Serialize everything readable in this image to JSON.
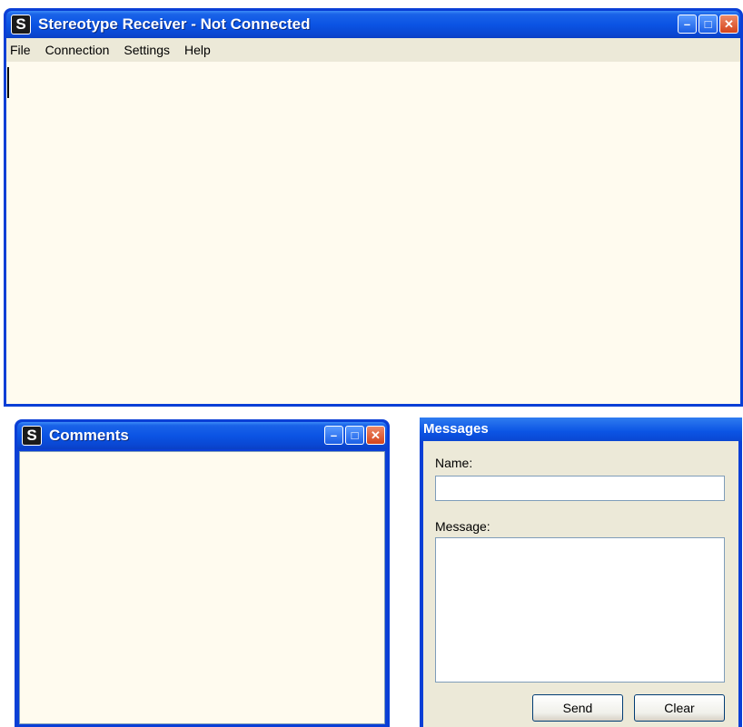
{
  "main_window": {
    "title": "Stereotype Receiver - Not Connected",
    "app_icon_letter": "S",
    "menu": [
      "File",
      "Connection",
      "Settings",
      "Help"
    ]
  },
  "comments_window": {
    "title": "Comments",
    "app_icon_letter": "S"
  },
  "messages_window": {
    "title": "Messages",
    "name_label": "Name:",
    "name_value": "",
    "message_label": "Message:",
    "message_value": "",
    "send_label": "Send",
    "clear_label": "Clear"
  },
  "window_controls": {
    "minimize": "–",
    "maximize": "□",
    "close": "✕"
  },
  "colors": {
    "titlebar_blue": "#0b54e4",
    "client_bg": "#fffbef",
    "dialog_bg": "#ece9d8",
    "close_red": "#d4441c"
  }
}
